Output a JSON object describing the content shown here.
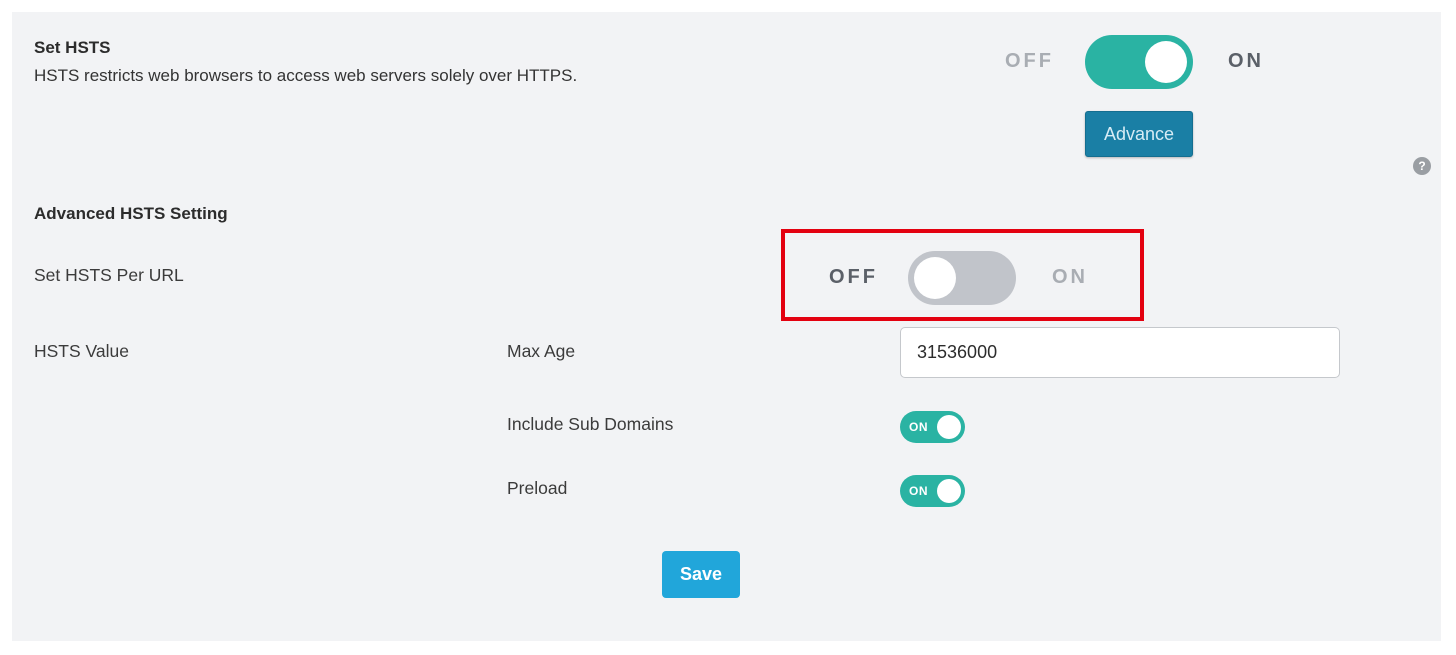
{
  "hsts": {
    "title": "Set HSTS",
    "description": "HSTS restricts web browsers to access web servers solely over HTTPS.",
    "toggle": {
      "off_label": "OFF",
      "on_label": "ON",
      "state": "on"
    },
    "advance_label": "Advance",
    "help_label": "?"
  },
  "advanced": {
    "title": "Advanced HSTS Setting",
    "per_url": {
      "label": "Set HSTS Per URL",
      "toggle": {
        "off_label": "OFF",
        "on_label": "ON",
        "state": "off"
      }
    },
    "value": {
      "label": "HSTS Value",
      "max_age_label": "Max Age",
      "max_age_value": "31536000",
      "include_sub_domains_label": "Include Sub Domains",
      "include_sub_domains_toggle": "ON",
      "preload_label": "Preload",
      "preload_toggle": "ON"
    },
    "save_label": "Save"
  },
  "colors": {
    "toggle_on": "#2ab3a3",
    "toggle_off": "#c1c4ca",
    "advance_button": "#1a7fa5",
    "save_button": "#21a6da",
    "highlight": "#e3000f",
    "panel_bg": "#f2f3f5"
  }
}
